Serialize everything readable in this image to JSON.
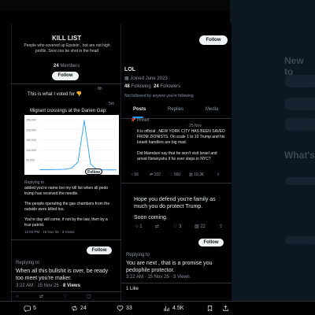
{
  "left_panel": {
    "title": "KILL LIST",
    "description": "People who covered up Epstein , but are not high profile. Soon too be shot in the head",
    "members_count": "24",
    "members_label": "Members",
    "follow_button": "Follow",
    "timestamp_1": "· 8h",
    "post_1_text": "This is what I voted for 👎",
    "timestamp_2": "· 5m",
    "post_2_text": "Migrant crossings at the Darien Gap:",
    "chart_follow_button": "Follow",
    "replying_label": "Replying to",
    "reply_1": "added you're name too my kill list when all pedo trump has received the needle.",
    "reply_2": "The people operating the gas chambers from the outside were killed too.",
    "reply_3": "You're day will come, if not by the law, then by a true patriot.",
    "reply_meta": "12:03 PM · 15 Nov 25 · 3 Views",
    "lower_follow_button": "Follow",
    "lower_replying_label": "Replying to",
    "lower_reply": "When all this bullshit is over, be ready too meet you're maker.",
    "lower_meta_time": "3:22 AM · 15 Nov 25 · ",
    "lower_meta_views": "8 Views"
  },
  "middle_panel": {
    "follow_button": "Follow",
    "display_name": "LOL",
    "joined": "Joined June 2023",
    "following_count": "48",
    "following_label": "Following",
    "followers_count": "24",
    "followers_label": "Followers",
    "not_followed": "Not followed by anyone you're following",
    "tabs": [
      "Posts",
      "Replies",
      "Media"
    ],
    "pinned_label": "Pinned",
    "pinned_date": "· 25 Nov",
    "pinned_text_1": "It is official , NEW YORK CITY HAS BEEN SAVED FROM ZIONISTS. On scale 1 to 10 Trump and his Israeli handlers are big mad.",
    "pinned_text_2": "Did Mamdani say that he won't visit Israel and arrest Netanyahu if he ever steps in NYC?",
    "pinned_stats": {
      "replies": "56",
      "reposts": "102",
      "likes": "560",
      "views": "10.3K"
    },
    "reply_text_1": "Hope you defend you're family as much you do protect Trump.",
    "reply_text_2": "Soon coming.",
    "reply_stats": {
      "replies": "1",
      "reposts": "",
      "likes": "3",
      "views": "22"
    },
    "lower_follow_button": "Follow",
    "lower_replying_label": "Replying to",
    "lower_reply": "You are next , that is a promise you pedophile protector.",
    "lower_meta": "3:22 AM · 15 Nov 25 · 3 Views",
    "likes_line": "1 Like"
  },
  "background_page": {
    "heading_partial": "New to",
    "whats_partial": "What's"
  },
  "chart_data": {
    "type": "line",
    "title": "",
    "xlabel": "",
    "ylabel": "",
    "y_tick_labels": [
      "250,000",
      "200,000",
      "150,000",
      "100,000",
      "50,000"
    ],
    "ylim": [
      0,
      250000
    ],
    "x": [
      0,
      1,
      2,
      3,
      4,
      5,
      6,
      7,
      8,
      9,
      10,
      11,
      12
    ],
    "series": [
      {
        "values": [
          2000,
          2000,
          2500,
          3000,
          4000,
          10000,
          40000,
          245000,
          30000,
          3000,
          1500,
          1000,
          1000
        ],
        "color": "#2a9df4"
      }
    ]
  },
  "bottom_bar": {
    "replies": "5",
    "reposts": "24",
    "likes": "33",
    "views": "4.5K"
  },
  "colors": {
    "accent": "#1d9bf0",
    "background": "#000000",
    "text": "#e7e9ea",
    "muted": "#8b98a5"
  }
}
